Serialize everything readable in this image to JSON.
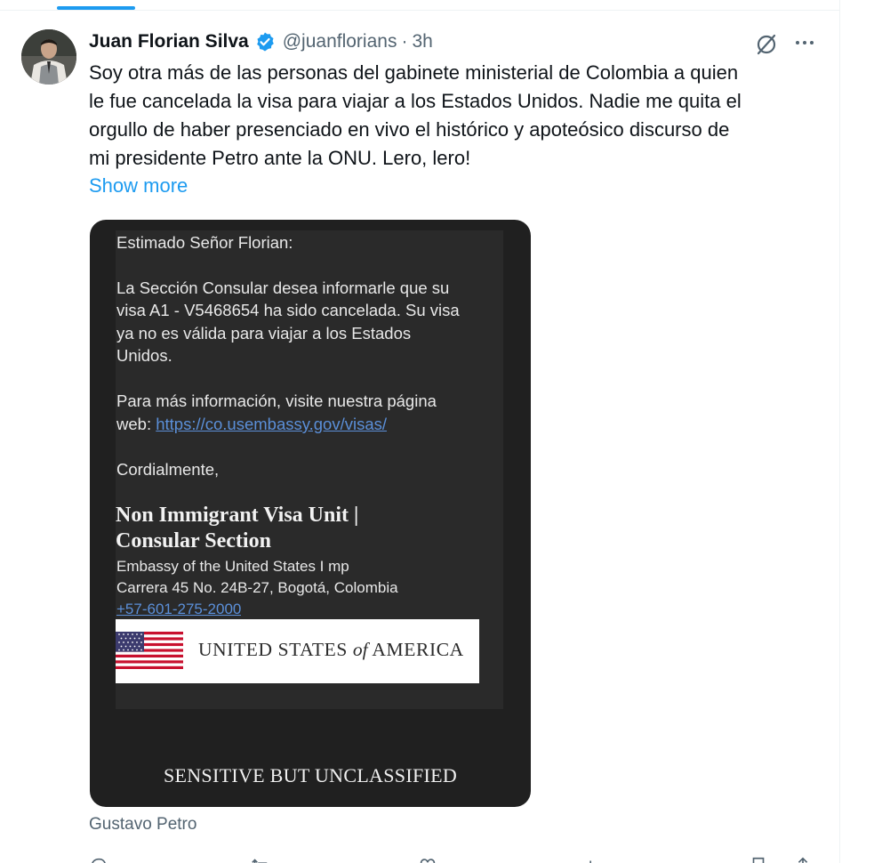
{
  "tweet": {
    "author_name": "Juan Florian Silva",
    "handle": "@juanflorians",
    "separator": "·",
    "time": "3h",
    "text_lines": [
      "Soy otra más de las personas del gabinete ministerial de Colombia a quien",
      "le fue cancelada la visa para viajar a los Estados Unidos. Nadie me quita el",
      "orgullo de haber presenciado en vivo el histórico y apoteósico discurso de",
      "mi presidente Petro ante la ONU. Lero, lero!"
    ],
    "show_more": "Show more",
    "attribution": "Gustavo Petro"
  },
  "letter": {
    "greeting": "Estimado Señor Florian:",
    "body_lines": [
      "La Sección Consular desea informarle que su",
      "visa A1 - V5468654 ha sido cancelada. Su visa",
      "ya no es válida para viajar a los Estados",
      "Unidos."
    ],
    "info_line1": "Para más información, visite nuestra página",
    "info_prefix": "web: ",
    "info_link": "https://co.usembassy.gov/visas/",
    "closing": "Cordialmente,",
    "unit_title_line1": "Non Immigrant Visa Unit |",
    "unit_title_line2": "Consular Section",
    "address_line1": "Embassy of the United States I mp",
    "address_line2": "Carrera 45 No. 24B-27, Bogotá, Colombia",
    "phone": "+57-601-275-2000",
    "banner_text_a": "UNITED STATES ",
    "banner_text_of": "of",
    "banner_text_b": " AMERICA",
    "footer": "SENSITIVE BUT UNCLASSIFIED"
  },
  "colors": {
    "accent": "#1d9bf0",
    "text_primary": "#0f1419",
    "text_secondary": "#536471",
    "media_background": "#202020"
  },
  "icons": {
    "verified": "verified-badge-icon",
    "grok": "grok-icon",
    "more": "more-icon",
    "reply": "reply-icon",
    "repost": "repost-icon",
    "like": "like-icon",
    "views": "views-icon",
    "bookmark": "bookmark-icon",
    "share": "share-icon"
  }
}
